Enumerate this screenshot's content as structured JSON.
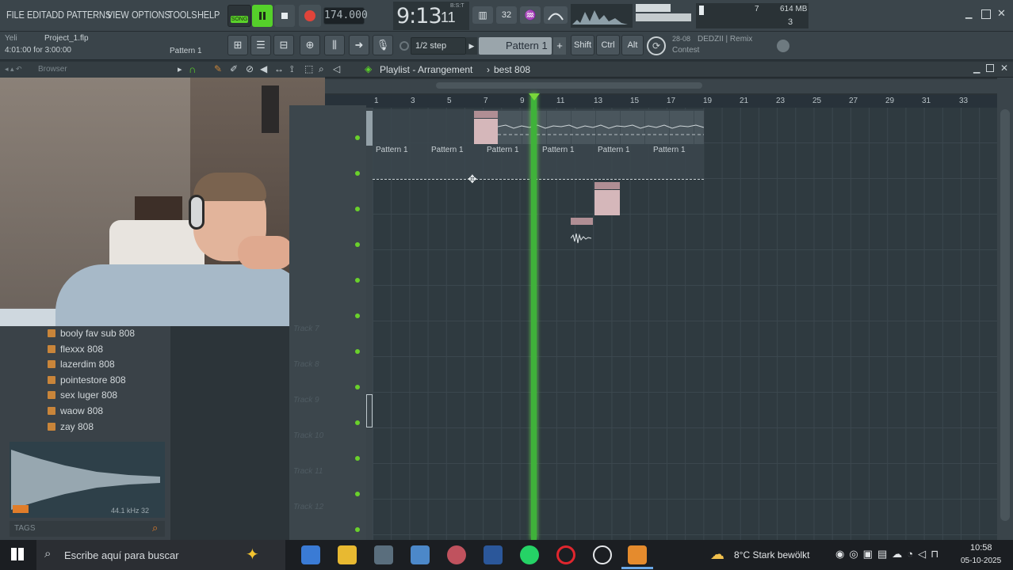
{
  "menu": [
    "FILE",
    "EDIT",
    "ADD",
    "PATTERNS",
    "VIEW",
    "OPTIONS",
    "TOOLS",
    "HELP"
  ],
  "transport": {
    "song_mode": "SONG",
    "tempo": "174.000",
    "time": "9:13",
    "time_sub": "11",
    "time_label": "B:S:T",
    "cpu": "7",
    "memory": "614 MB",
    "polyphony": "3"
  },
  "info_bar": {
    "project": "Project_1.flp",
    "hint_prefix": "Yeli",
    "duration": "4:01:00 for 3:00:00",
    "pattern_small": "Pattern 1",
    "snap": "1/2 step",
    "pattern_selector": "Pattern 1",
    "shift": "Shift",
    "ctrl": "Ctrl",
    "alt": "Alt",
    "news_date": "28-08",
    "news_title": "DEDZII | Remix",
    "news_subtitle": "Contest"
  },
  "browser": {
    "title": "Browser",
    "items": [
      "booly fav sub 808",
      "flexxx 808",
      "lazerdim 808",
      "pointestore 808",
      "sex luger 808",
      "waow 808",
      "zay 808"
    ],
    "sample_info": "44.1 kHz 32",
    "tags": "TAGS"
  },
  "playlist": {
    "breadcrumb": "Playlist - Arrangement",
    "pattern": "best 808",
    "ruler": [
      "1",
      "3",
      "5",
      "7",
      "9",
      "11",
      "13",
      "15",
      "17",
      "19",
      "21",
      "23",
      "25",
      "27",
      "29",
      "31",
      "33"
    ],
    "pattern_clips": [
      "Pattern 1",
      "Pattern 1",
      "Pattern 1",
      "Pattern 1",
      "Pattern 1",
      "Pattern 1"
    ],
    "tracks": [
      "Track 7",
      "Track 8",
      "Track 9",
      "Track 10",
      "Track 11",
      "Track 12"
    ]
  },
  "taskbar": {
    "search_placeholder": "Escribe aquí para buscar",
    "weather": "8°C  Stark bewölkt",
    "time": "10:58",
    "date": "05-10-2025"
  },
  "colors": {
    "accent_green": "#3fb23a",
    "clip_pink": "#d5b7ba",
    "record_red": "#e0443a",
    "folder_orange": "#c9853a"
  }
}
